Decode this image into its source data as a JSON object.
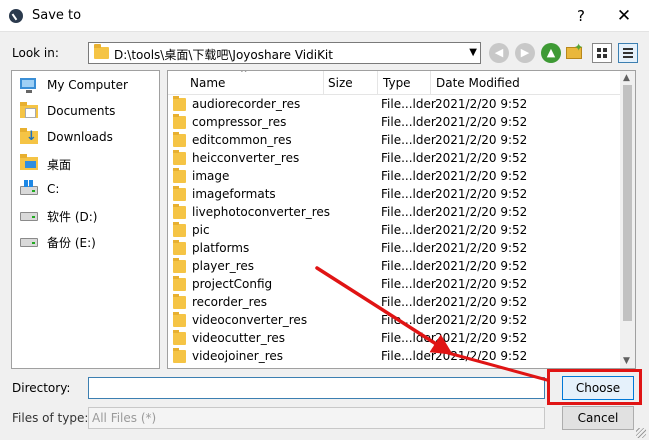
{
  "dialog": {
    "title": "Save to",
    "help_label": "?",
    "close_label": "✕"
  },
  "toolbar": {
    "look_in_label": "Look in:",
    "path": "D:\\tools\\桌面\\下载吧\\Joyoshare VidiKit"
  },
  "sidebar": {
    "items": [
      {
        "label": "My Computer",
        "icon": "computer-icon"
      },
      {
        "label": "Documents",
        "icon": "documents-folder-icon"
      },
      {
        "label": "Downloads",
        "icon": "downloads-folder-icon"
      },
      {
        "label": "桌面",
        "icon": "desktop-folder-icon"
      },
      {
        "label": "C:",
        "icon": "drive-icon"
      },
      {
        "label": "软件 (D:)",
        "icon": "drive-icon"
      },
      {
        "label": "备份 (E:)",
        "icon": "drive-icon"
      }
    ]
  },
  "filelist": {
    "columns": {
      "name": "Name",
      "size": "Size",
      "type": "Type",
      "date": "Date Modified"
    },
    "rows": [
      {
        "name": "audiorecorder_res",
        "type": "File...lder",
        "date": "2021/2/20 9:52"
      },
      {
        "name": "compressor_res",
        "type": "File...lder",
        "date": "2021/2/20 9:52"
      },
      {
        "name": "editcommon_res",
        "type": "File...lder",
        "date": "2021/2/20 9:52"
      },
      {
        "name": "heicconverter_res",
        "type": "File...lder",
        "date": "2021/2/20 9:52"
      },
      {
        "name": "image",
        "type": "File...lder",
        "date": "2021/2/20 9:52"
      },
      {
        "name": "imageformats",
        "type": "File...lder",
        "date": "2021/2/20 9:52"
      },
      {
        "name": "livephotoconverter_res",
        "type": "File...lder",
        "date": "2021/2/20 9:52"
      },
      {
        "name": "pic",
        "type": "File...lder",
        "date": "2021/2/20 9:52"
      },
      {
        "name": "platforms",
        "type": "File...lder",
        "date": "2021/2/20 9:52"
      },
      {
        "name": "player_res",
        "type": "File...lder",
        "date": "2021/2/20 9:52"
      },
      {
        "name": "projectConfig",
        "type": "File...lder",
        "date": "2021/2/20 9:52"
      },
      {
        "name": "recorder_res",
        "type": "File...lder",
        "date": "2021/2/20 9:52"
      },
      {
        "name": "videoconverter_res",
        "type": "File...lder",
        "date": "2021/2/20 9:52"
      },
      {
        "name": "videocutter_res",
        "type": "File...lder",
        "date": "2021/2/20 9:52"
      },
      {
        "name": "videojoiner_res",
        "type": "File...lder",
        "date": "2021/2/20 9:52"
      }
    ]
  },
  "bottom": {
    "directory_label": "Directory:",
    "directory_value": "",
    "files_of_type_label": "Files of type:",
    "files_of_type_value": "All Files (*)",
    "choose_label": "Choose",
    "cancel_label": "Cancel"
  },
  "colors": {
    "accent": "#0078d7",
    "annotation": "#e01414",
    "folder": "#f5c445"
  }
}
